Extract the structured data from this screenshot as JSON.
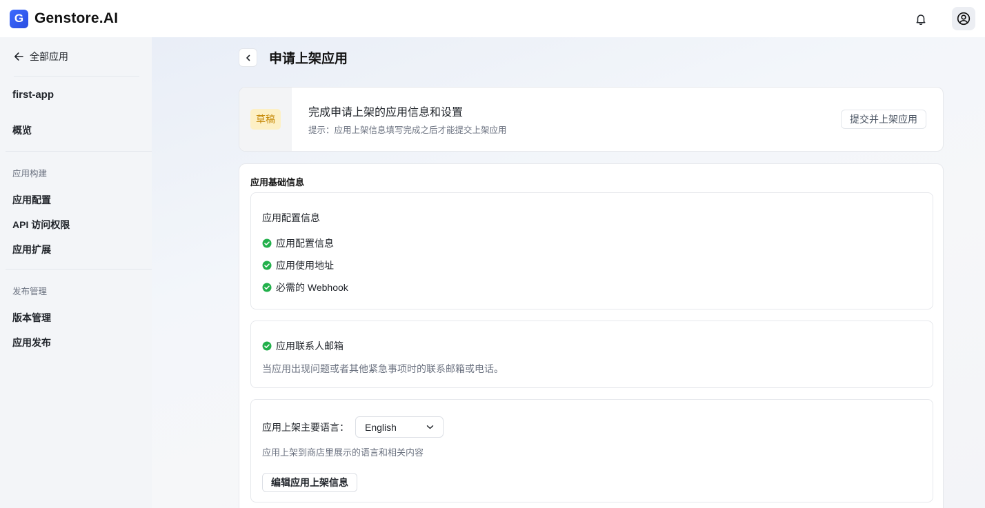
{
  "header": {
    "logo_letter": "G",
    "brand": "Genstore.AI",
    "icons": {
      "notification": "bell-icon",
      "profile": "user-circle-icon"
    }
  },
  "sidebar": {
    "back_label": "全部应用",
    "app_name": "first-app",
    "overview": "概览",
    "sections": [
      {
        "title": "应用构建",
        "items": [
          "应用配置",
          "API 访问权限",
          "应用扩展"
        ]
      },
      {
        "title": "发布管理",
        "items": [
          "版本管理",
          "应用发布"
        ]
      }
    ]
  },
  "main": {
    "page_title": "申请上架应用",
    "status": {
      "badge": "草稿",
      "title": "完成申请上架的应用信息和设置",
      "hint": "提示：应用上架信息填写完成之后才能提交上架应用",
      "submit_label": "提交并上架应用"
    },
    "basic_info": {
      "title": "应用基础信息",
      "config": {
        "heading": "应用配置信息",
        "checks": [
          "应用配置信息",
          "应用使用地址",
          "必需的 Webhook"
        ]
      },
      "contact": {
        "label": "应用联系人邮箱",
        "desc": "当应用出现问题或者其他紧急事项时的联系邮箱或电话。"
      },
      "language": {
        "label": "应用上架主要语言：",
        "selected": "English",
        "desc": "应用上架到商店里展示的语言和相关内容",
        "edit_label": "编辑应用上架信息"
      }
    }
  },
  "colors": {
    "accent": "#3d6bff",
    "success": "#22b04b",
    "badge_bg": "#fdf0c5",
    "badge_text": "#c68a0a"
  }
}
